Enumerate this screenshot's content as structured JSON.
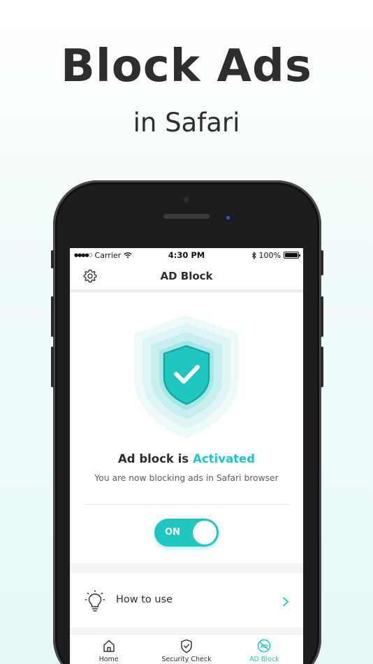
{
  "promo": {
    "headline": "Block Ads",
    "subline": "in Safari"
  },
  "status_bar": {
    "carrier": "Carrier",
    "time": "4:30 PM",
    "battery": "100%"
  },
  "header": {
    "title": "AD Block"
  },
  "main": {
    "status_prefix": "Ad block is",
    "status_value": "Activated",
    "description": "You are now blocking ads in Safari browser",
    "toggle_label": "ON"
  },
  "how_to": {
    "label": "How to use"
  },
  "tabs": [
    {
      "label": "Home",
      "icon": "home-icon"
    },
    {
      "label": "Security Check",
      "icon": "shield-check-icon"
    },
    {
      "label": "AD Block",
      "icon": "ad-block-icon"
    }
  ],
  "colors": {
    "accent": "#1ec7c0",
    "text": "#2c2e30"
  }
}
